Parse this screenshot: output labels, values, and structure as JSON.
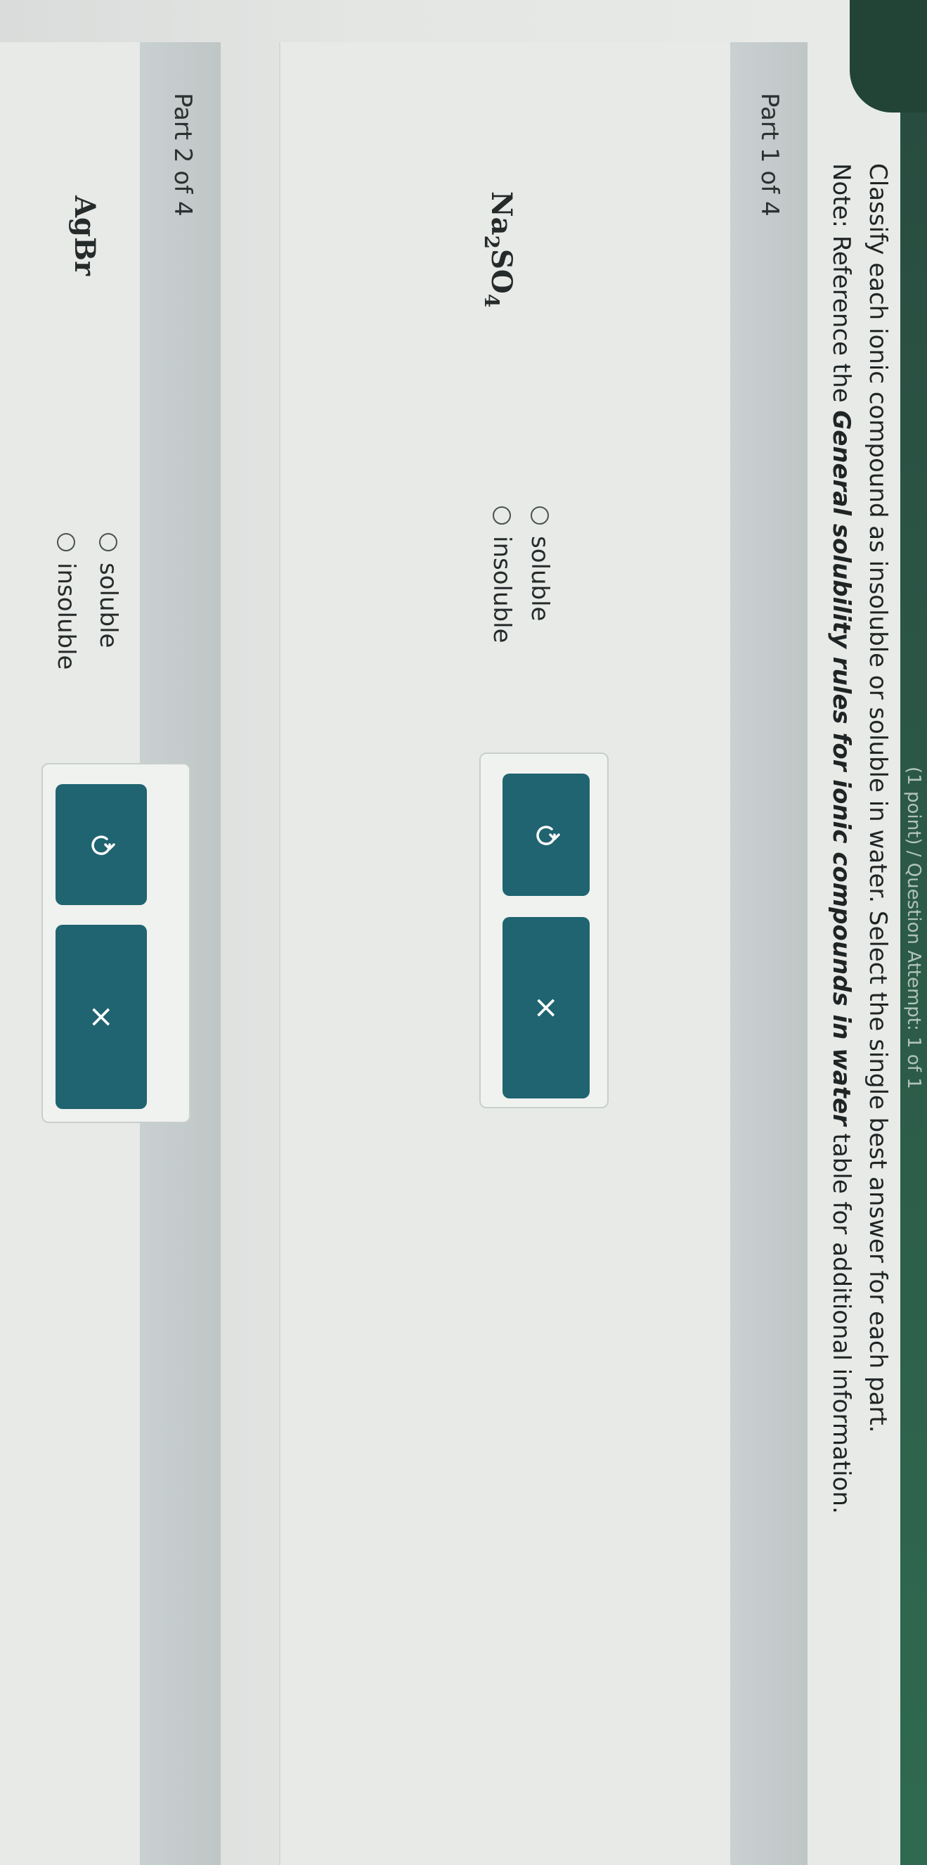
{
  "header": {
    "partial_text": "(1 point) / Question Attempt: 1 of 1"
  },
  "question": {
    "instruction": "Classify each ionic compound as insoluble or soluble in water. Select the single best answer for each part.",
    "note_prefix": "Note: Reference the ",
    "note_emphasis": "General solubility rules for ionic compounds in water",
    "note_suffix": " table for additional information."
  },
  "parts": [
    {
      "title": "Part 1 of 4",
      "formula": {
        "base1": "Na",
        "sub1": "2",
        "base2": "SO",
        "sub2": "4"
      },
      "options": [
        "soluble",
        "insoluble"
      ],
      "selected": null,
      "reset_icon": "undo-icon",
      "clear_icon": "close-icon",
      "clear_label": "×"
    },
    {
      "title": "Part 2 of 4",
      "formula": {
        "base1": "AgBr"
      },
      "options": [
        "soluble",
        "insoluble"
      ],
      "selected": null,
      "reset_icon": "undo-icon",
      "clear_icon": "close-icon",
      "clear_label": "×"
    }
  ],
  "colors": {
    "accent_button": "#1f6470",
    "header_band": "#c4cbcb",
    "top_strip": "#2c5a48"
  }
}
